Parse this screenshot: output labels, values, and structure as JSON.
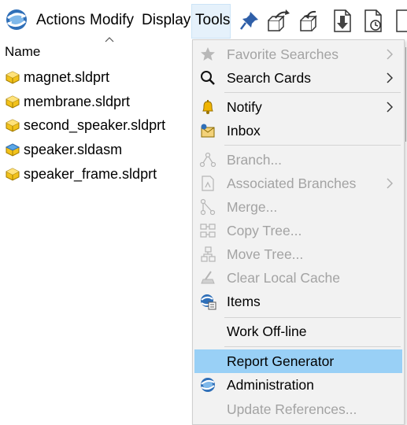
{
  "menubar": {
    "items": [
      "Actions",
      "Modify",
      "Display",
      "Tools"
    ]
  },
  "file_list": {
    "column_header": "Name",
    "files": [
      {
        "name": "magnet.sldprt",
        "icon": "part-icon"
      },
      {
        "name": "membrane.sldprt",
        "icon": "part-icon"
      },
      {
        "name": "second_speaker.sldprt",
        "icon": "part-icon"
      },
      {
        "name": "speaker.sldasm",
        "icon": "assembly-icon"
      },
      {
        "name": "speaker_frame.sldprt",
        "icon": "part-icon"
      }
    ]
  },
  "tools_menu": {
    "items": [
      {
        "label": "Favorite Searches",
        "enabled": false,
        "submenu": true,
        "icon": "star-icon"
      },
      {
        "label": "Search Cards",
        "enabled": true,
        "submenu": true,
        "icon": "search-icon"
      },
      {
        "label": "Notify",
        "enabled": true,
        "submenu": true,
        "icon": "bell-icon"
      },
      {
        "label": "Inbox",
        "enabled": true,
        "submenu": false,
        "icon": "inbox-icon"
      },
      {
        "label": "Branch...",
        "enabled": false,
        "submenu": false,
        "icon": "branch-icon"
      },
      {
        "label": "Associated Branches",
        "enabled": false,
        "submenu": true,
        "icon": "associated-branches-icon"
      },
      {
        "label": "Merge...",
        "enabled": false,
        "submenu": false,
        "icon": "merge-icon"
      },
      {
        "label": "Copy Tree...",
        "enabled": false,
        "submenu": false,
        "icon": "copy-tree-icon"
      },
      {
        "label": "Move Tree...",
        "enabled": false,
        "submenu": false,
        "icon": "move-tree-icon"
      },
      {
        "label": "Clear Local Cache",
        "enabled": false,
        "submenu": false,
        "icon": "clear-cache-icon"
      },
      {
        "label": "Items",
        "enabled": true,
        "submenu": false,
        "icon": "items-icon"
      },
      {
        "label": "Work Off-line",
        "enabled": true,
        "submenu": false,
        "icon": ""
      },
      {
        "label": "Report Generator",
        "enabled": true,
        "submenu": false,
        "icon": "",
        "highlighted": true
      },
      {
        "label": "Administration",
        "enabled": true,
        "submenu": false,
        "icon": "administration-icon"
      },
      {
        "label": "Update References...",
        "enabled": false,
        "submenu": false,
        "icon": ""
      }
    ]
  },
  "colors": {
    "highlight": "#99d0f6",
    "disabled_text": "#a3a3a3",
    "menu_background": "#f2f2f2",
    "tools_hover": "#e5f1fb"
  }
}
